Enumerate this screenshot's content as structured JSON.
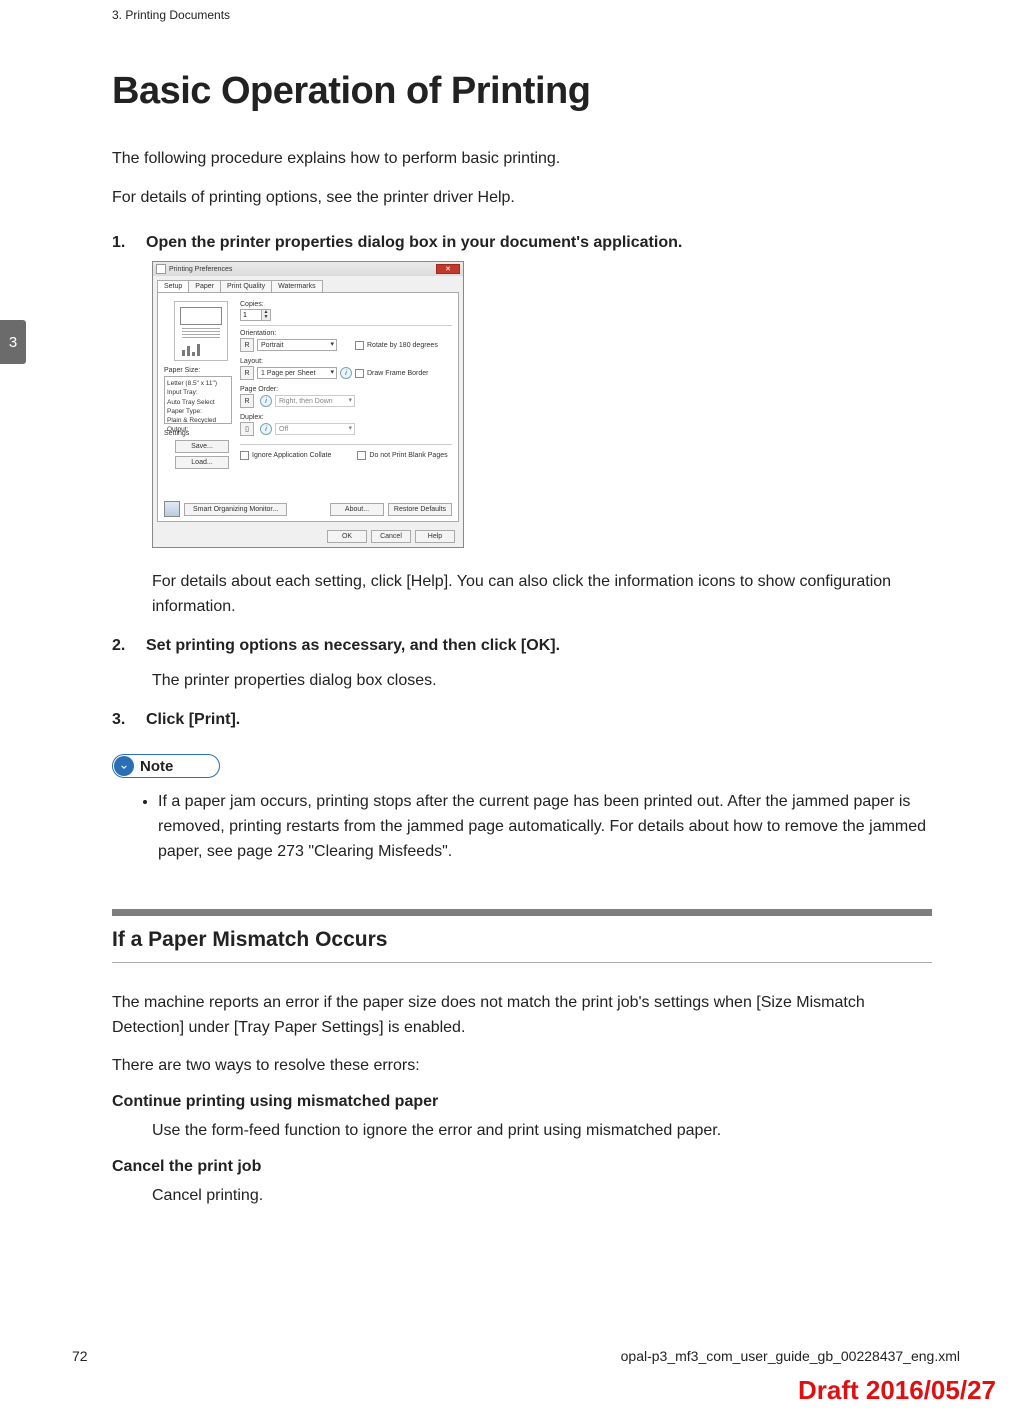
{
  "header_label": "3. Printing Documents",
  "side_tab": "3",
  "title": "Basic Operation of Printing",
  "intro1": "The following procedure explains how to perform basic printing.",
  "intro2": "For details of printing options, see the printer driver Help.",
  "steps": {
    "s1": {
      "num": "1.",
      "head": "Open the printer properties dialog box in your document's application.",
      "body": "For details about each setting, click [Help]. You can also click the information icons to show configuration information."
    },
    "s2": {
      "num": "2.",
      "head": "Set printing options as necessary, and then click [OK].",
      "body": "The printer properties dialog box closes."
    },
    "s3": {
      "num": "3.",
      "head": "Click [Print]."
    }
  },
  "dialog": {
    "title": "Printing Preferences",
    "tabs": [
      "Setup",
      "Paper",
      "Print Quality",
      "Watermarks"
    ],
    "copies_label": "Copies:",
    "copies_value": "1",
    "orientation_label": "Orientation:",
    "orientation_value": "Portrait",
    "rotate_label": "Rotate by 180 degrees",
    "layout_label": "Layout:",
    "layout_value": "1 Page per Sheet",
    "draw_border_label": "Draw Frame Border",
    "page_order_label": "Page Order:",
    "page_order_value": "Right, then Down",
    "duplex_label": "Duplex:",
    "duplex_value": "Off",
    "left_section_label": "Paper Size:",
    "left_list": [
      "Letter (8.5\" x 11\")",
      "Input Tray:",
      "  Auto Tray Select",
      "Paper Type:",
      "  Plain & Recycled",
      "Output:"
    ],
    "settings_label": "Settings",
    "save_btn": "Save...",
    "load_btn": "Load...",
    "ignore_collate": "Ignore Application Collate",
    "no_blank": "Do not Print Blank Pages",
    "som_btn": "Smart Organizing Monitor...",
    "about_btn": "About...",
    "restore_btn": "Restore Defaults",
    "ok": "OK",
    "cancel": "Cancel",
    "help": "Help",
    "r_btn": "R"
  },
  "note": {
    "label": "Note",
    "item": "If a paper jam occurs, printing stops after the current page has been printed out. After the jammed paper is removed, printing restarts from the jammed page automatically. For details about how to remove the jammed paper, see page 273 \"Clearing Misfeeds\"."
  },
  "subheading": "If a Paper Mismatch Occurs",
  "sub1": "The machine reports an error if the paper size does not match the print job's settings when [Size Mismatch Detection] under [Tray Paper Settings] is enabled.",
  "sub2": "There are two ways to resolve these errors:",
  "opt1_head": "Continue printing using mismatched paper",
  "opt1_body": "Use the form-feed function to ignore the error and print using mismatched paper.",
  "opt2_head": "Cancel the print job",
  "opt2_body": "Cancel printing.",
  "page_number": "72",
  "footer_path": "opal-p3_mf3_com_user_guide_gb_00228437_eng.xml",
  "draft": "Draft 2016/05/27"
}
